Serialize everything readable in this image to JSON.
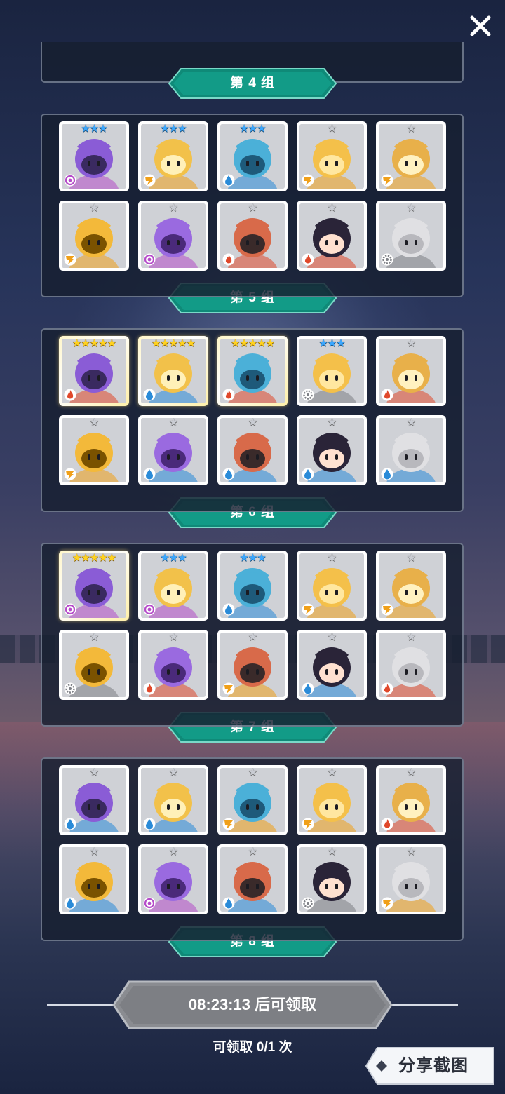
{
  "screen": {
    "close_icon": "close-icon"
  },
  "elements": {
    "arcane": {
      "icon": "arcane-swirl-icon",
      "color": "#b54cc9"
    },
    "electric": {
      "icon": "electric-bolt-icon",
      "color": "#f0a01a"
    },
    "water": {
      "icon": "water-drop-icon",
      "color": "#2a8bd8"
    },
    "fire": {
      "icon": "fire-flame-icon",
      "color": "#e0482b"
    },
    "light": {
      "icon": "light-gear-icon",
      "color": "#7d7f85"
    }
  },
  "star_colors": {
    "silver": "#c9ccd3",
    "blue": "#3aa7ff",
    "gold": "#ffd21f"
  },
  "groups": [
    {
      "label": "第 4 组"
    },
    {
      "label": "第 5 组",
      "heroes": [
        {
          "name": "purple-witch",
          "stars": 3,
          "tier": "blue",
          "element": "arcane"
        },
        {
          "name": "blonde-masked-girl",
          "stars": 3,
          "tier": "blue",
          "element": "electric"
        },
        {
          "name": "blue-fish-creature",
          "stars": 3,
          "tier": "blue",
          "element": "water"
        },
        {
          "name": "blonde-bow-girl",
          "stars": 1,
          "tier": "silver",
          "element": "electric"
        },
        {
          "name": "cactus",
          "stars": 1,
          "tier": "silver",
          "element": "electric"
        },
        {
          "name": "yellow-skull",
          "stars": 1,
          "tier": "silver",
          "element": "electric"
        },
        {
          "name": "purple-cat-mage",
          "stars": 1,
          "tier": "silver",
          "element": "arcane"
        },
        {
          "name": "goggles-boy",
          "stars": 1,
          "tier": "silver",
          "element": "fire"
        },
        {
          "name": "shrine-maiden",
          "stars": 1,
          "tier": "silver",
          "element": "fire"
        },
        {
          "name": "stone-moai",
          "stars": 1,
          "tier": "silver",
          "element": "light"
        }
      ]
    },
    {
      "label": "第 6 组",
      "heroes": [
        {
          "name": "fire-golem",
          "stars": 5,
          "tier": "gold",
          "element": "fire"
        },
        {
          "name": "witch-hat-girl",
          "stars": 5,
          "tier": "gold",
          "element": "water"
        },
        {
          "name": "pink-hair-girl",
          "stars": 5,
          "tier": "gold",
          "element": "fire"
        },
        {
          "name": "white-hair-girl",
          "stars": 3,
          "tier": "blue",
          "element": "light"
        },
        {
          "name": "pink-octopus",
          "stars": 1,
          "tier": "silver",
          "element": "fire"
        },
        {
          "name": "blonde-knight",
          "stars": 1,
          "tier": "silver",
          "element": "electric"
        },
        {
          "name": "winged-knight",
          "stars": 1,
          "tier": "silver",
          "element": "water"
        },
        {
          "name": "blue-mage",
          "stars": 1,
          "tier": "silver",
          "element": "water"
        },
        {
          "name": "blue-box-robot",
          "stars": 1,
          "tier": "silver",
          "element": "water"
        },
        {
          "name": "blue-dragon",
          "stars": 1,
          "tier": "silver",
          "element": "water"
        }
      ]
    },
    {
      "label": "第 7 组",
      "heroes": [
        {
          "name": "panda-fighter",
          "stars": 5,
          "tier": "gold",
          "element": "arcane"
        },
        {
          "name": "purple-dragon",
          "stars": 3,
          "tier": "blue",
          "element": "arcane"
        },
        {
          "name": "hooded-shadow",
          "stars": 3,
          "tier": "blue",
          "element": "water"
        },
        {
          "name": "bandaged-mummy",
          "stars": 1,
          "tier": "silver",
          "element": "electric"
        },
        {
          "name": "bandaged-mummy-2",
          "stars": 1,
          "tier": "silver",
          "element": "electric"
        },
        {
          "name": "white-beast",
          "stars": 1,
          "tier": "silver",
          "element": "light"
        },
        {
          "name": "pink-octopus-2",
          "stars": 1,
          "tier": "silver",
          "element": "fire"
        },
        {
          "name": "tiger-monk",
          "stars": 1,
          "tier": "silver",
          "element": "electric"
        },
        {
          "name": "blue-fox-girl",
          "stars": 1,
          "tier": "silver",
          "element": "water"
        },
        {
          "name": "red-rock-golem",
          "stars": 1,
          "tier": "silver",
          "element": "fire"
        }
      ]
    },
    {
      "label": "第 8 组",
      "heroes": [
        {
          "name": "blue-furball",
          "stars": 1,
          "tier": "silver",
          "element": "water"
        },
        {
          "name": "blue-mummy",
          "stars": 1,
          "tier": "silver",
          "element": "water"
        },
        {
          "name": "tiger-monk-2",
          "stars": 1,
          "tier": "silver",
          "element": "electric"
        },
        {
          "name": "lion-warrior",
          "stars": 1,
          "tier": "silver",
          "element": "electric"
        },
        {
          "name": "goggles-boy-2",
          "stars": 1,
          "tier": "silver",
          "element": "fire"
        },
        {
          "name": "blue-antler-girl",
          "stars": 1,
          "tier": "silver",
          "element": "water"
        },
        {
          "name": "purple-antler-girl",
          "stars": 1,
          "tier": "silver",
          "element": "arcane"
        },
        {
          "name": "winged-knight-2",
          "stars": 1,
          "tier": "silver",
          "element": "water"
        },
        {
          "name": "stone-ram",
          "stars": 1,
          "tier": "silver",
          "element": "light"
        },
        {
          "name": "giraffe",
          "stars": 1,
          "tier": "silver",
          "element": "electric"
        }
      ]
    }
  ],
  "claim": {
    "label": "08:23:13 后可领取",
    "count_text": "可领取 0/1 次"
  },
  "share": {
    "label": "分享截图"
  }
}
